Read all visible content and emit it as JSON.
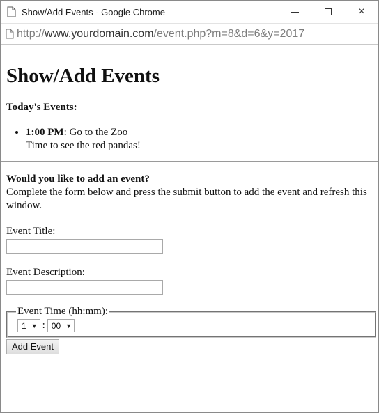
{
  "window": {
    "title": "Show/Add Events - Google Chrome",
    "minimize_label": "",
    "maximize_label": "",
    "close_label": "×"
  },
  "address": {
    "prefix": "http://",
    "host": "www.yourdomain.com",
    "path": "/event.php?m=8&d=6&y=2017"
  },
  "page": {
    "heading": "Show/Add Events",
    "today_heading": "Today's Events:",
    "events": [
      {
        "time": "1:00 PM",
        "title": ": Go to the Zoo",
        "description": "Time to see the red pandas!"
      }
    ],
    "add_heading": "Would you like to add an event?",
    "instructions": "Complete the form below and press the submit button to add the event and refresh this window.",
    "form": {
      "title_label": "Event Title:",
      "title_value": "",
      "description_label": "Event Description:",
      "description_value": "",
      "time_legend": "Event Time (hh:mm):",
      "hour_value": "1",
      "separator": ":",
      "minute_value": "00",
      "submit_label": "Add Event"
    }
  },
  "icons": {
    "tab_page": "page-icon",
    "address_page": "page-icon",
    "dropdown": "chevron-down-icon"
  },
  "colors": {
    "url_host": "#333333",
    "url_rest": "#7d7d7d"
  }
}
